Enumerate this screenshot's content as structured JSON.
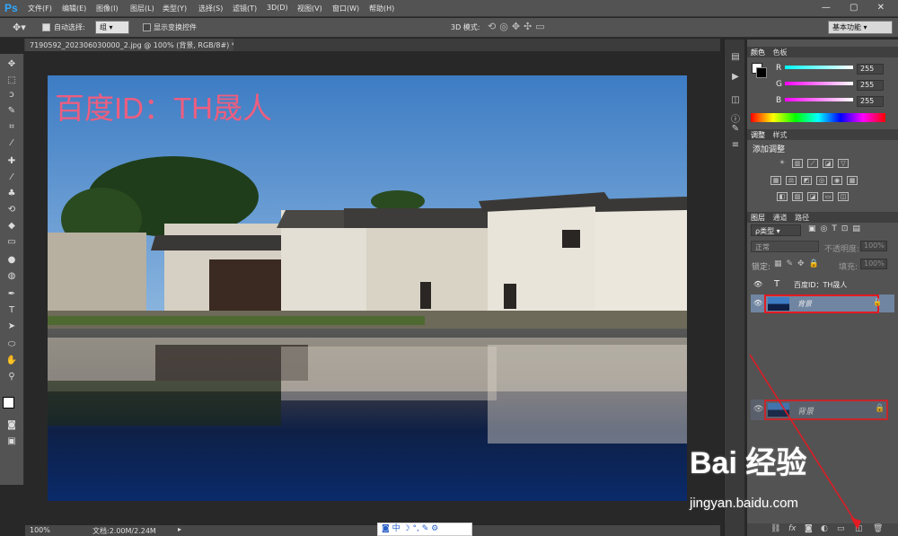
{
  "app": {
    "logo": "Ps"
  },
  "menu": [
    "文件(F)",
    "编辑(E)",
    "图像(I)",
    "图层(L)",
    "类型(Y)",
    "选择(S)",
    "滤镜(T)",
    "3D(D)",
    "视图(V)",
    "窗口(W)",
    "帮助(H)"
  ],
  "window_controls": "— ▢ ✕",
  "options": {
    "auto_select_label": "自动选择:",
    "auto_select_value": "组",
    "show_transform_label": "显示变换控件",
    "mode_3d_label": "3D 模式:",
    "workspace": "基本功能"
  },
  "document": {
    "tab_title": "7190592_202306030000_2.jpg @ 100% (背景, RGB/8#) *",
    "watermark": "百度ID：TH晟人"
  },
  "status": {
    "zoom": "100%",
    "doc": "文档:2.00M/2.24M"
  },
  "ime": {
    "items": [
      "中",
      "☽",
      "°,",
      "✎",
      "⚙"
    ]
  },
  "panels": {
    "color_tabs": [
      "颜色",
      "色板"
    ],
    "channels": [
      {
        "label": "R",
        "value": "255",
        "color": "#00ffff"
      },
      {
        "label": "G",
        "value": "255",
        "color": "#ff00ff"
      },
      {
        "label": "B",
        "value": "255",
        "color": "#ff00ff"
      }
    ],
    "adjust_tabs": [
      "调整",
      "样式"
    ],
    "adjust_title": "添加调整",
    "layers_tabs": [
      "图层",
      "通道",
      "路径"
    ],
    "kind_filter": "ρ类型",
    "blend_mode": "正常",
    "opacity_label": "不透明度:",
    "opacity_value": "100%",
    "lock_label": "锁定:",
    "fill_label": "填充:",
    "fill_value": "100%",
    "layers": [
      {
        "name": "百度ID：TH晟人",
        "type": "text"
      },
      {
        "name": "背景",
        "type": "image"
      }
    ],
    "drag_ghost_label": "背景"
  },
  "watermark_brand": {
    "text": "Bai 经验",
    "url": "jingyan.baidu.com"
  },
  "colors": {
    "accent": "#e31b23",
    "ps_blue": "#31a8ff"
  }
}
